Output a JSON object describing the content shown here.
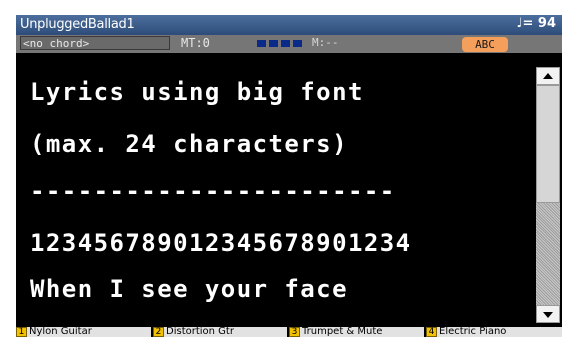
{
  "titlebar": {
    "song_title": "UnpluggedBallad1",
    "tempo": "♩= 94"
  },
  "status": {
    "chord": "<no chord>",
    "mt": "MT:0",
    "meter_label": "M:--",
    "abc_button": "ABC"
  },
  "lyrics": {
    "lines": [
      "Lyrics using big font",
      "(max. 24 characters)",
      "-----------------------",
      "123456789012345678901234",
      "When I see your face"
    ]
  },
  "tracks": [
    {
      "number": "1",
      "name": "Nylon Guitar"
    },
    {
      "number": "2",
      "name": "Distortion Gtr"
    },
    {
      "number": "3",
      "name": "Trumpet & Mute"
    },
    {
      "number": "4",
      "name": "Electric Piano"
    }
  ]
}
